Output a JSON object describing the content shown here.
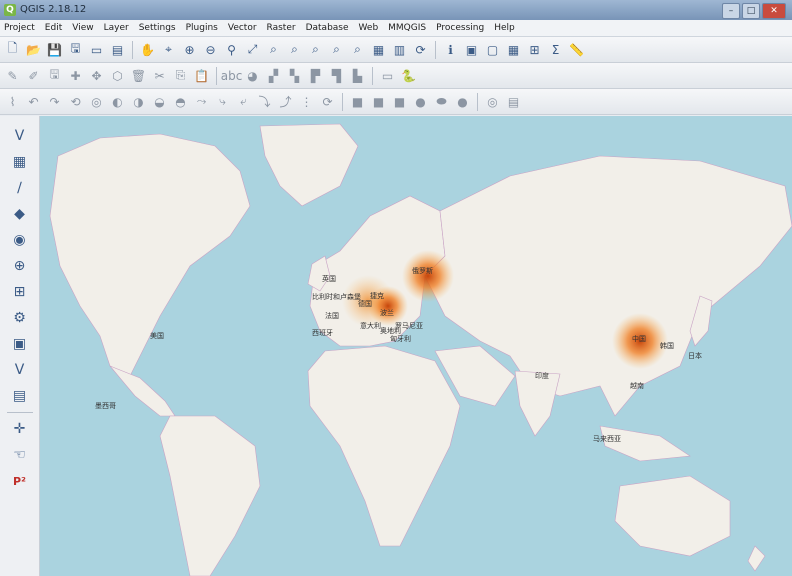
{
  "window": {
    "title": "QGIS 2.18.12"
  },
  "menu": [
    "Project",
    "Edit",
    "View",
    "Layer",
    "Settings",
    "Plugins",
    "Vector",
    "Raster",
    "Database",
    "Web",
    "MMQGIS",
    "Processing",
    "Help"
  ],
  "toolbar1": [
    {
      "name": "new-project-icon",
      "glyph": "🗋"
    },
    {
      "name": "open-project-icon",
      "glyph": "📂"
    },
    {
      "name": "save-project-icon",
      "glyph": "💾"
    },
    {
      "name": "save-as-icon",
      "glyph": "🖫"
    },
    {
      "name": "new-print-composer-icon",
      "glyph": "▭"
    },
    {
      "name": "composer-manager-icon",
      "glyph": "▤"
    },
    {
      "name": "sep"
    },
    {
      "name": "pan-icon",
      "glyph": "✋"
    },
    {
      "name": "pan-to-selection-icon",
      "glyph": "⌖"
    },
    {
      "name": "zoom-in-icon",
      "glyph": "⊕"
    },
    {
      "name": "zoom-out-icon",
      "glyph": "⊖"
    },
    {
      "name": "zoom-rubber-icon",
      "glyph": "⚲"
    },
    {
      "name": "zoom-full-icon",
      "glyph": "⤢"
    },
    {
      "name": "zoom-selection-icon",
      "glyph": "⌕"
    },
    {
      "name": "zoom-layer-icon",
      "glyph": "⌕"
    },
    {
      "name": "zoom-native-icon",
      "glyph": "⌕"
    },
    {
      "name": "zoom-last-icon",
      "glyph": "⌕"
    },
    {
      "name": "zoom-next-icon",
      "glyph": "⌕"
    },
    {
      "name": "new-map-view-icon",
      "glyph": "▦"
    },
    {
      "name": "bookmark-icon",
      "glyph": "▥"
    },
    {
      "name": "refresh-icon",
      "glyph": "⟳"
    },
    {
      "name": "sep"
    },
    {
      "name": "identify-icon",
      "glyph": "ℹ"
    },
    {
      "name": "select-feature-icon",
      "glyph": "▣"
    },
    {
      "name": "deselect-icon",
      "glyph": "▢"
    },
    {
      "name": "open-attribute-table-icon",
      "glyph": "▦"
    },
    {
      "name": "field-calculator-icon",
      "glyph": "⊞"
    },
    {
      "name": "statistics-icon",
      "glyph": "Σ"
    },
    {
      "name": "measure-icon",
      "glyph": "📏"
    }
  ],
  "toolbar2": [
    {
      "name": "edit-pencil-icon",
      "glyph": "✎"
    },
    {
      "name": "toggle-editing-icon",
      "glyph": "✐"
    },
    {
      "name": "save-edits-icon",
      "glyph": "🖫"
    },
    {
      "name": "add-feature-icon",
      "glyph": "✚"
    },
    {
      "name": "move-feature-icon",
      "glyph": "✥"
    },
    {
      "name": "node-tool-icon",
      "glyph": "⬡"
    },
    {
      "name": "delete-selected-icon",
      "glyph": "🗑"
    },
    {
      "name": "cut-features-icon",
      "glyph": "✂"
    },
    {
      "name": "copy-features-icon",
      "glyph": "⎘"
    },
    {
      "name": "paste-features-icon",
      "glyph": "📋"
    },
    {
      "name": "sep"
    },
    {
      "name": "label-tool-icon",
      "glyph": "abc"
    },
    {
      "name": "diagram-icon",
      "glyph": "◕"
    },
    {
      "name": "pin-label-icon",
      "glyph": "▞"
    },
    {
      "name": "show-hide-labels-icon",
      "glyph": "▚"
    },
    {
      "name": "move-label-icon",
      "glyph": "▛"
    },
    {
      "name": "rotate-label-icon",
      "glyph": "▜"
    },
    {
      "name": "change-label-icon",
      "glyph": "▙"
    },
    {
      "name": "sep"
    },
    {
      "name": "scale-bar-icon",
      "glyph": "▭"
    },
    {
      "name": "python-console-icon",
      "glyph": "🐍"
    }
  ],
  "toolbar3": [
    {
      "name": "digitize-icon",
      "glyph": "⌇"
    },
    {
      "name": "undo-icon",
      "glyph": "↶"
    },
    {
      "name": "redo-icon",
      "glyph": "↷"
    },
    {
      "name": "simplify-icon",
      "glyph": "⟲"
    },
    {
      "name": "add-ring-icon",
      "glyph": "◎"
    },
    {
      "name": "add-part-icon",
      "glyph": "◐"
    },
    {
      "name": "fill-ring-icon",
      "glyph": "◑"
    },
    {
      "name": "delete-ring-icon",
      "glyph": "◒"
    },
    {
      "name": "delete-part-icon",
      "glyph": "◓"
    },
    {
      "name": "reshape-icon",
      "glyph": "⤳"
    },
    {
      "name": "offset-curve-icon",
      "glyph": "⤷"
    },
    {
      "name": "split-features-icon",
      "glyph": "⤶"
    },
    {
      "name": "split-parts-icon",
      "glyph": "⤵"
    },
    {
      "name": "merge-features-icon",
      "glyph": "⤴"
    },
    {
      "name": "merge-attributes-icon",
      "glyph": "⋮"
    },
    {
      "name": "rotate-symbols-icon",
      "glyph": "⟳"
    },
    {
      "name": "sep"
    },
    {
      "name": "shape-square-icon",
      "glyph": "■"
    },
    {
      "name": "shape-square2-icon",
      "glyph": "■"
    },
    {
      "name": "shape-square3-icon",
      "glyph": "■"
    },
    {
      "name": "shape-circle-icon",
      "glyph": "●"
    },
    {
      "name": "shape-ellipse-icon",
      "glyph": "⬬"
    },
    {
      "name": "shape-circle2-icon",
      "glyph": "●"
    },
    {
      "name": "sep"
    },
    {
      "name": "spiral-icon",
      "glyph": "◎"
    },
    {
      "name": "grid-icon",
      "glyph": "▤"
    }
  ],
  "sidebar": [
    {
      "name": "add-vector-layer-icon",
      "glyph": "V"
    },
    {
      "name": "add-raster-layer-icon",
      "glyph": "▦"
    },
    {
      "name": "add-delimited-text-icon",
      "glyph": "∕"
    },
    {
      "name": "add-spatialite-icon",
      "glyph": "◆"
    },
    {
      "name": "add-postgis-icon",
      "glyph": "◉"
    },
    {
      "name": "add-wms-icon",
      "glyph": "⊕"
    },
    {
      "name": "add-wcs-icon",
      "glyph": "⊞"
    },
    {
      "name": "add-wfs-icon",
      "glyph": "⚙"
    },
    {
      "name": "add-virtual-layer-icon",
      "glyph": "▣"
    },
    {
      "name": "new-shapefile-icon",
      "glyph": "V"
    },
    {
      "name": "new-spatialite-layer-icon",
      "glyph": "▤"
    },
    {
      "name": "sep"
    },
    {
      "name": "coordinate-capture-icon",
      "glyph": "✛"
    },
    {
      "name": "georeferencer-icon",
      "glyph": "☜"
    },
    {
      "name": "georef-points-icon",
      "glyph": "P²"
    }
  ],
  "map": {
    "ocean_color": "#aad3df",
    "land_color": "#f2efe9",
    "border_color": "#c9a3c5",
    "labels": [
      {
        "text": "英国"
      },
      {
        "text": "比利时和卢森堡"
      },
      {
        "text": "法国"
      },
      {
        "text": "西班牙"
      },
      {
        "text": "德国"
      },
      {
        "text": "捷克"
      },
      {
        "text": "意大利"
      },
      {
        "text": "波兰"
      },
      {
        "text": "奥地利"
      },
      {
        "text": "罗马尼亚"
      },
      {
        "text": "俄罗斯"
      },
      {
        "text": "匈牙利"
      },
      {
        "text": "美国"
      },
      {
        "text": "墨西哥"
      },
      {
        "text": "中国"
      },
      {
        "text": "韩国"
      },
      {
        "text": "日本"
      },
      {
        "text": "印度"
      },
      {
        "text": "越南"
      },
      {
        "text": "马来西亚"
      }
    ]
  }
}
